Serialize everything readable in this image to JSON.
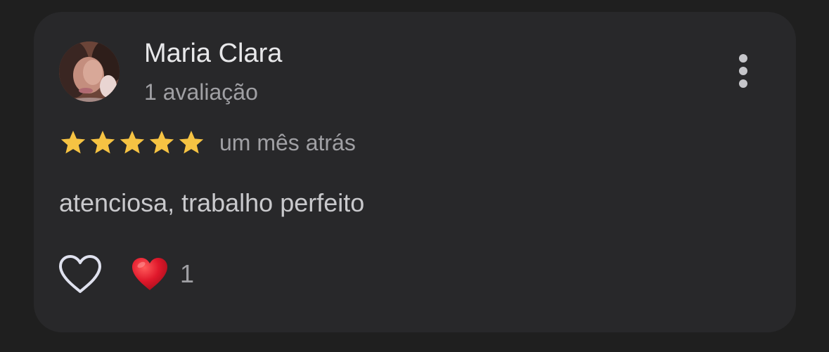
{
  "review": {
    "author_name": "Maria Clara",
    "review_count": "1 avaliação",
    "rating": 5,
    "rating_max": 5,
    "date": "um mês atrás",
    "text": "atenciosa, trabalho perfeito",
    "reactions": {
      "heart_count": "1"
    }
  },
  "icons": {
    "menu": "more-vert-icon",
    "like": "heart-outline-icon",
    "reaction": "red-heart-icon",
    "star": "star-icon"
  },
  "colors": {
    "page_background": "#1f1f1f",
    "card_background": "#28282a",
    "star": "#f6c343",
    "heart": "#e0182b",
    "primary_text": "#e8e8ea",
    "secondary_text": "#a0a0a4"
  }
}
